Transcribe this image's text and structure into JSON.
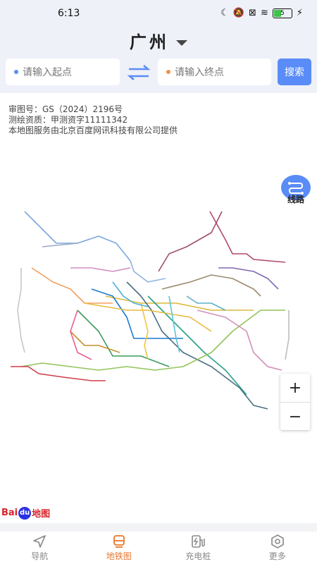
{
  "status_bar": {
    "time": "6:13",
    "battery": "5"
  },
  "header": {
    "city": "广州",
    "start_placeholder": "请输入起点",
    "end_placeholder": "请输入终点",
    "search_label": "搜索"
  },
  "map": {
    "notice_lines": [
      "审图号：GS（2024）2196号",
      "测绘资质：甲测资字11111342",
      "本地图服务由北京百度网讯科技有限公司提供"
    ],
    "route_label": "线路",
    "zoom_in": "+",
    "zoom_out": "−",
    "logo_text": {
      "bai": "Bai",
      "du": "du",
      "map": "地图"
    }
  },
  "tabs": [
    {
      "label": "导航",
      "icon": "navigation-icon",
      "active": false
    },
    {
      "label": "地铁图",
      "icon": "metro-icon",
      "active": true
    },
    {
      "label": "充电桩",
      "icon": "charging-pile-icon",
      "active": false
    },
    {
      "label": "更多",
      "icon": "more-icon",
      "active": false
    }
  ],
  "colors": {
    "accent": "#5a8cf7",
    "active_tab": "#e9762b",
    "header_bg": "#eef1f8"
  }
}
